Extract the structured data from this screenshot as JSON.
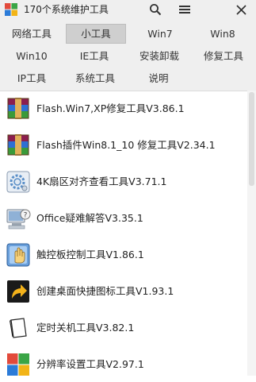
{
  "window": {
    "title": "170个系统维护工具"
  },
  "titlebar": {
    "search_icon": "search-icon",
    "menu_icon": "menu-icon",
    "close_icon": "close-icon"
  },
  "tabs": [
    {
      "label": "网络工具"
    },
    {
      "label": "小工具"
    },
    {
      "label": "Win7"
    },
    {
      "label": "Win8"
    },
    {
      "label": "Win10"
    },
    {
      "label": "IE工具"
    },
    {
      "label": "安装卸载"
    },
    {
      "label": "修复工具"
    },
    {
      "label": "IP工具"
    },
    {
      "label": "系统工具"
    },
    {
      "label": "说明"
    }
  ],
  "tools": [
    {
      "label": "Flash.Win7,XP修复工具V3.86.1",
      "icon": "winrar-box-icon"
    },
    {
      "label": "Flash插件Win8.1_10 修复工具V2.34.1",
      "icon": "winrar-box-icon"
    },
    {
      "label": "4K扇区对齐查看工具V3.71.1",
      "icon": "disk-gear-icon"
    },
    {
      "label": "Office疑难解答V3.35.1",
      "icon": "computer-question-icon"
    },
    {
      "label": "触控板控制工具V1.86.1",
      "icon": "touch-hand-icon"
    },
    {
      "label": "创建桌面快捷图标工具V1.93.1",
      "icon": "shortcut-arrow-icon"
    },
    {
      "label": "定时关机工具V3.82.1",
      "icon": "document-icon"
    },
    {
      "label": "分辨率设置工具V2.97.1",
      "icon": "windows-logo-icon"
    }
  ],
  "colors": {
    "titlebar_bg": "#efefef",
    "active_tab_bg": "#cfcfcf"
  }
}
